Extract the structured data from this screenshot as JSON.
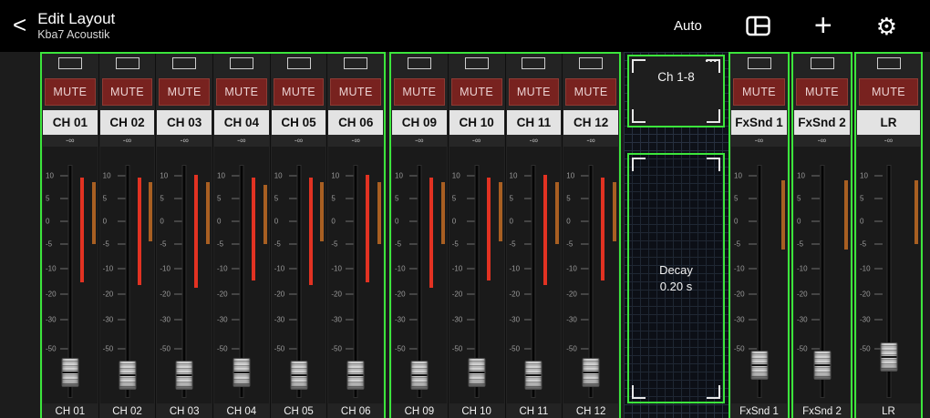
{
  "icons": {
    "back": "<",
    "add": "+",
    "settings": "⚙",
    "menu_dots": "•••"
  },
  "header": {
    "title": "Edit Layout",
    "subtitle": "Kba7 Acoustik",
    "auto_label": "Auto"
  },
  "fader_scale": [
    "10",
    "5",
    "0",
    "-5",
    "-10",
    "-20",
    "-30",
    "-50"
  ],
  "channel_groups": [
    {
      "name": "channels-1-6",
      "strips": [
        {
          "mute_label": "MUTE",
          "name": "CH 01",
          "value": "-∞",
          "bottom_label": "CH 01",
          "red": [
            12,
            53
          ],
          "orange": [
            14,
            38
          ],
          "fader": 88
        },
        {
          "mute_label": "MUTE",
          "name": "CH 02",
          "value": "-∞",
          "bottom_label": "CH 02",
          "red": [
            12,
            54
          ],
          "orange": [
            14,
            37
          ],
          "fader": 89
        },
        {
          "mute_label": "MUTE",
          "name": "CH 03",
          "value": "-∞",
          "bottom_label": "CH 03",
          "red": [
            11,
            55
          ],
          "orange": [
            14,
            38
          ],
          "fader": 89
        },
        {
          "mute_label": "MUTE",
          "name": "CH 04",
          "value": "-∞",
          "bottom_label": "CH 04",
          "red": [
            12,
            52
          ],
          "orange": [
            15,
            38
          ],
          "fader": 88
        },
        {
          "mute_label": "MUTE",
          "name": "CH 05",
          "value": "-∞",
          "bottom_label": "CH 05",
          "red": [
            12,
            54
          ],
          "orange": [
            14,
            37
          ],
          "fader": 89
        },
        {
          "mute_label": "MUTE",
          "name": "CH 06",
          "value": "-∞",
          "bottom_label": "CH 06",
          "red": [
            11,
            53
          ],
          "orange": [
            14,
            38
          ],
          "fader": 89
        }
      ]
    },
    {
      "name": "channels-9-12",
      "strips": [
        {
          "mute_label": "MUTE",
          "name": "CH 09",
          "value": "-∞",
          "bottom_label": "CH 09",
          "red": [
            12,
            55
          ],
          "orange": [
            14,
            38
          ],
          "fader": 89
        },
        {
          "mute_label": "MUTE",
          "name": "CH 10",
          "value": "-∞",
          "bottom_label": "CH 10",
          "red": [
            12,
            52
          ],
          "orange": [
            14,
            37
          ],
          "fader": 88
        },
        {
          "mute_label": "MUTE",
          "name": "CH 11",
          "value": "-∞",
          "bottom_label": "CH 11",
          "red": [
            11,
            54
          ],
          "orange": [
            14,
            38
          ],
          "fader": 89
        },
        {
          "mute_label": "MUTE",
          "name": "CH 12",
          "value": "-∞",
          "bottom_label": "CH 12",
          "red": [
            12,
            52
          ],
          "orange": [
            14,
            37
          ],
          "fader": 88
        }
      ]
    }
  ],
  "right_strips": [
    {
      "mute_label": "MUTE",
      "name": "FxSnd 1",
      "value": "-∞",
      "bottom_label": "FxSnd 1",
      "red": null,
      "orange": [
        13,
        40
      ],
      "fader": 85
    },
    {
      "mute_label": "MUTE",
      "name": "FxSnd 2",
      "value": "-∞",
      "bottom_label": "FxSnd 2",
      "red": null,
      "orange": [
        13,
        40
      ],
      "fader": 85
    },
    {
      "mute_label": "MUTE",
      "name": "LR",
      "value": "-∞",
      "bottom_label": "LR",
      "red": null,
      "orange": [
        13,
        38
      ],
      "fader": 82
    }
  ],
  "panels": {
    "bank": {
      "label": "Ch 1-8"
    },
    "decay": {
      "title": "Decay",
      "value": "0.20 s"
    }
  },
  "colors": {
    "accent_green": "#3ce53c",
    "mute_red": "#78221f",
    "meter_red": "#e23222",
    "meter_orange": "#a85f22",
    "name_bg": "#e3e3e3"
  }
}
